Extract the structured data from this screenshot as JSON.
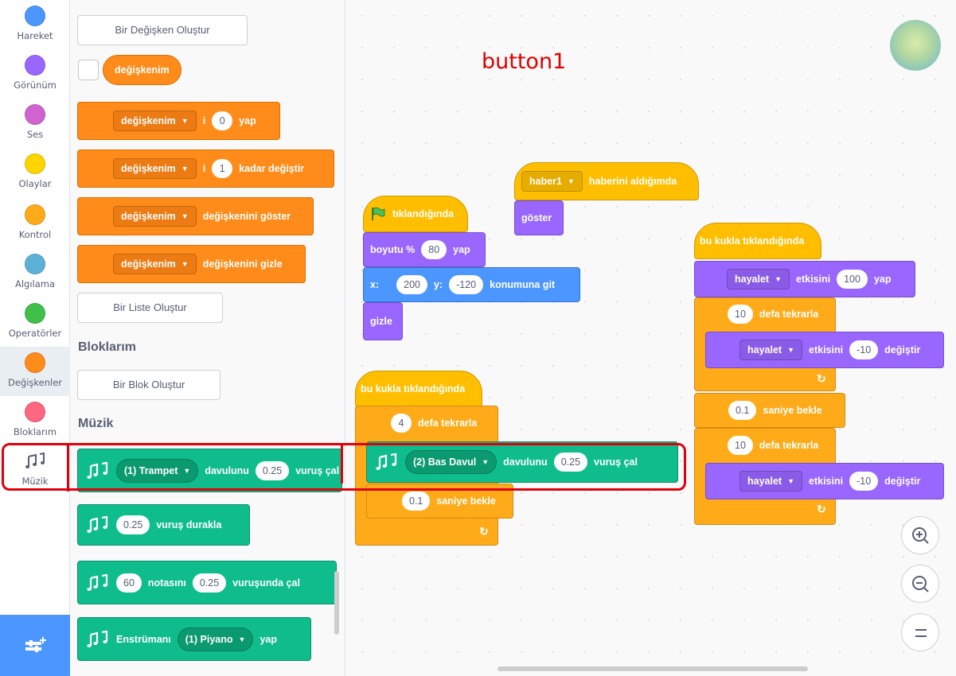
{
  "categories": [
    {
      "label": "Hareket",
      "color": "#4c97ff"
    },
    {
      "label": "Görünüm",
      "color": "#9966ff"
    },
    {
      "label": "Ses",
      "color": "#cf63cf"
    },
    {
      "label": "Olaylar",
      "color": "#ffd500"
    },
    {
      "label": "Kontrol",
      "color": "#ffab19"
    },
    {
      "label": "Algılama",
      "color": "#5cb1d6"
    },
    {
      "label": "Operatörler",
      "color": "#40bf4a"
    },
    {
      "label": "Değişkenler",
      "color": "#ff8c1a"
    },
    {
      "label": "Bloklarım",
      "color": "#ff6680"
    },
    {
      "label": "Müzik",
      "icon": "music-notes-icon"
    }
  ],
  "flyout": {
    "make_variable_button": "Bir Değişken Oluştur",
    "variable_name": "değişkenim",
    "set_block": {
      "var": "değişkenim",
      "i": "i",
      "value": "0",
      "suffix": "yap"
    },
    "change_block": {
      "var": "değişkenim",
      "i": "i",
      "value": "1",
      "suffix": "kadar değiştir"
    },
    "show_block": {
      "var": "değişkenim",
      "suffix": "değişkenini göster"
    },
    "hide_block": {
      "var": "değişkenim",
      "suffix": "değişkenini gizle"
    },
    "make_list_button": "Bir Liste Oluştur",
    "my_blocks_heading": "Bloklarım",
    "make_block_button": "Bir Blok Oluştur",
    "music_heading": "Müzik",
    "play_drum": {
      "drum": "(1) Trampet",
      "label": "davulunu",
      "beats": "0.25",
      "suffix": "vuruş çal"
    },
    "rest": {
      "beats": "0.25",
      "label": "vuruş durakla"
    },
    "play_note": {
      "note": "60",
      "label": "notasını",
      "beats": "0.25",
      "suffix": "vuruşunda çal"
    },
    "set_instrument": {
      "label": "Enstrümanı",
      "instrument": "(1) Piyano",
      "suffix": "yap"
    }
  },
  "annotation": {
    "label": "button1",
    "color": "#e0000b"
  },
  "scripts": {
    "broadcast_script": {
      "hat_message": "haber1",
      "hat_label": "haberini aldığımda",
      "show": "göster"
    },
    "flag_script": {
      "hat_label": "tıklandığında",
      "size": {
        "label": "boyutu %",
        "value": "80",
        "suffix": "yap"
      },
      "goto": {
        "x_label": "x:",
        "x": "200",
        "y_label": "y:",
        "y": "-120",
        "suffix": "konumuna git"
      },
      "hide": "gizle"
    },
    "click_script_1": {
      "hat_label": "bu kukla tıklandığında",
      "repeat": {
        "times": "4",
        "label": "defa tekrarla"
      },
      "play_drum": {
        "drum": "(2) Bas Davul",
        "label": "davulunu",
        "beats": "0.25",
        "suffix": "vuruş çal"
      },
      "wait": {
        "secs": "0.1",
        "label": "saniye bekle"
      }
    },
    "click_script_2": {
      "hat_label": "bu kukla tıklandığında",
      "set_effect": {
        "effect": "hayalet",
        "label": "etkisini",
        "value": "100",
        "suffix": "yap"
      },
      "repeat1": {
        "times": "10",
        "label": "defa tekrarla"
      },
      "change_effect1": {
        "effect": "hayalet",
        "label": "etkisini",
        "value": "-10",
        "suffix": "değiştir"
      },
      "wait": {
        "secs": "0.1",
        "label": "saniye bekle"
      },
      "repeat2": {
        "times": "10",
        "label": "defa tekrarla"
      },
      "change_effect2": {
        "effect": "hayalet",
        "label": "etkisini",
        "value": "-10",
        "suffix": "değiştir"
      }
    }
  },
  "zoom": {
    "in": "+",
    "out": "−",
    "reset": "="
  }
}
